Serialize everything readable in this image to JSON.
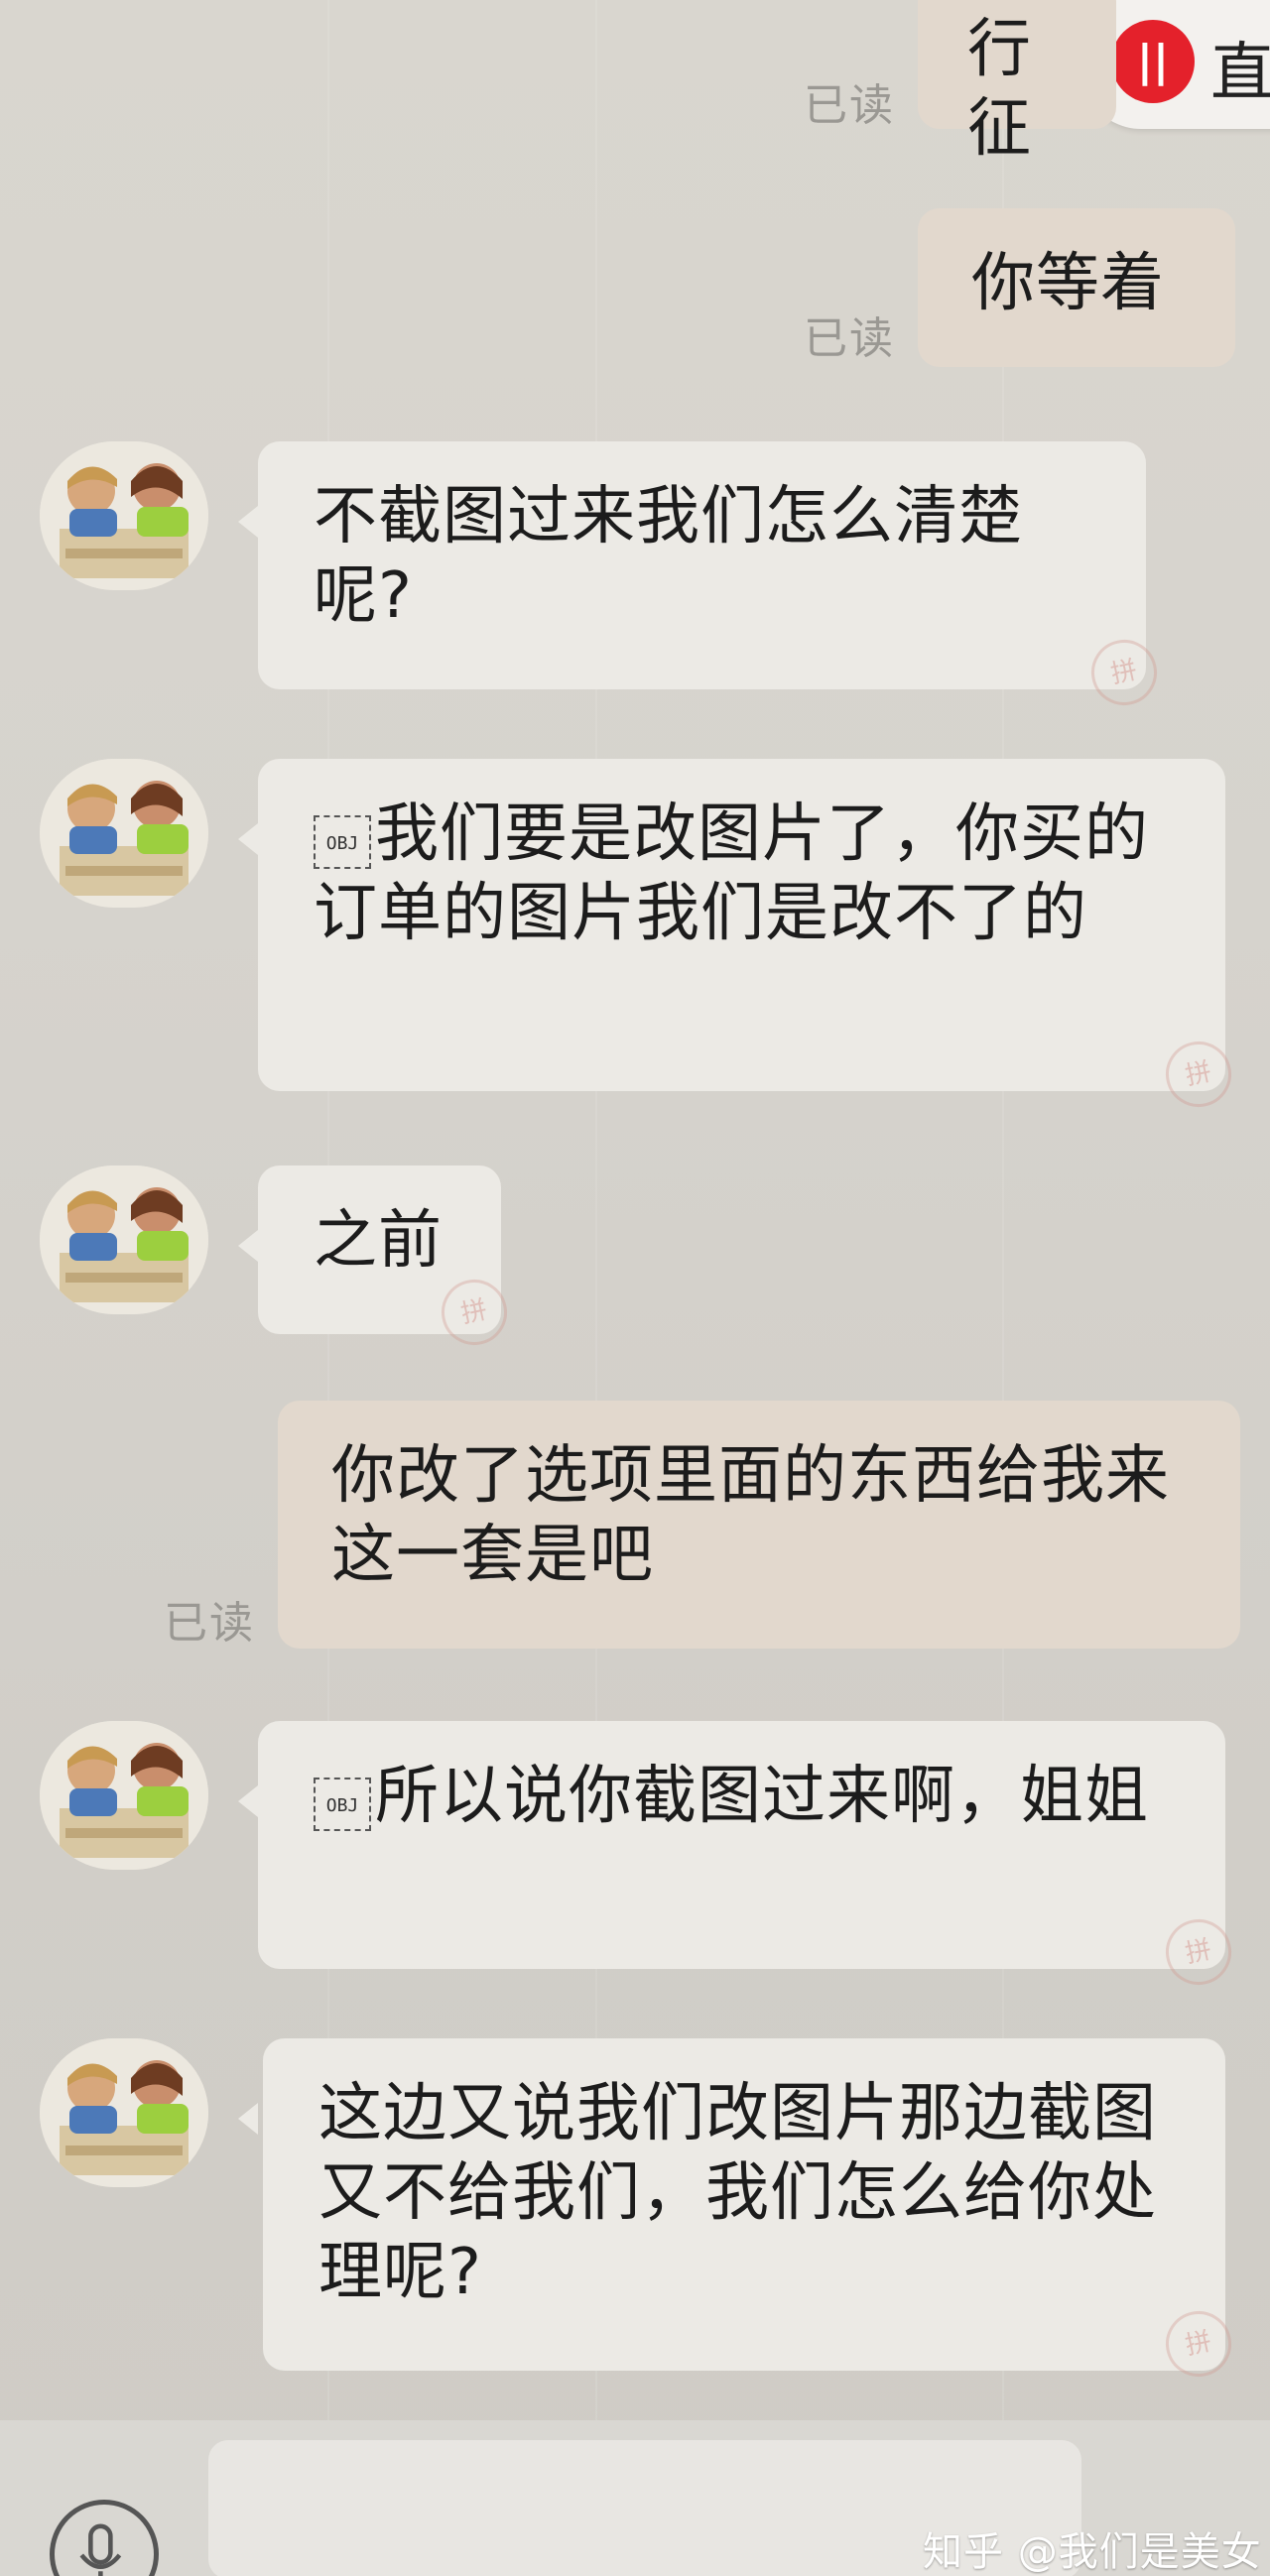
{
  "header": {
    "live_badge_icon": "live-logo-icon",
    "live_badge_label": "直",
    "live_badge_logo_text": "||"
  },
  "messages": [
    {
      "side": "out",
      "text": "行征",
      "read": "已读"
    },
    {
      "side": "out",
      "text": "你等着",
      "read": "已读"
    },
    {
      "side": "in",
      "text": "不截图过来我们怎么清楚呢?"
    },
    {
      "side": "in",
      "obj": "OBJ",
      "text": "我们要是改图片了，你买的订单的图片我们是改不了的"
    },
    {
      "side": "in",
      "text": "之前"
    },
    {
      "side": "out",
      "text": "你改了选项里面的东西给我来这一套是吧",
      "read": "已读"
    },
    {
      "side": "in",
      "obj": "OBJ",
      "text": "所以说你截图过来啊，姐姐"
    },
    {
      "side": "in",
      "text": "这边又说我们改图片那边截图又不给我们，我们怎么给你处理呢?"
    }
  ],
  "stamp_text": "拼",
  "footer": {
    "mic_icon": "microphone-icon",
    "watermark": "知乎 @我们是美女"
  }
}
